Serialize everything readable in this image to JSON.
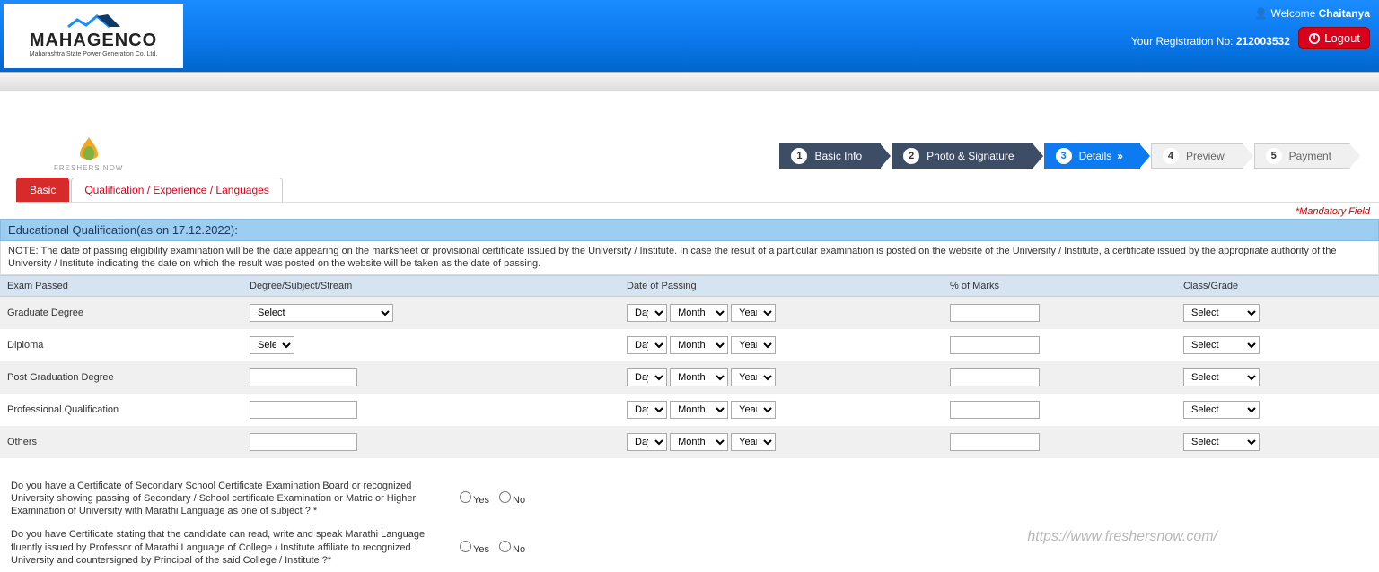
{
  "header": {
    "logo_main": "MAHAGENCO",
    "logo_sub": "Maharashtra State Power Generation Co. Ltd.",
    "welcome_prefix": "Welcome ",
    "welcome_name": "Chaitanya",
    "reg_label": "Your Registration No: ",
    "reg_no": "212003532",
    "logout": "Logout"
  },
  "freshers": {
    "label": "FRESHERS NOW"
  },
  "wizard": {
    "s1": "Basic Info",
    "s2": "Photo & Signature",
    "s3": "Details",
    "s4": "Preview",
    "s5": "Payment"
  },
  "tabs": {
    "basic": "Basic",
    "qual": "Qualification / Experience / Languages"
  },
  "mandatory": "*Mandatory Field",
  "section_title": "Educational Qualification(as on 17.12.2022):",
  "note": "NOTE: The date of passing eligibility examination will be the date appearing on the marksheet or provisional certificate issued by the University / Institute. In case the result of a particular examination is posted on the website of the University / Institute, a certificate issued by the appropriate authority of the University / Institute indicating the date on which the result was posted on the website will be taken as the date of passing.",
  "cols": {
    "exam": "Exam Passed",
    "degree": "Degree/Subject/Stream",
    "dop": "Date of Passing",
    "marks": "% of Marks",
    "grade": "Class/Grade"
  },
  "rows": {
    "r1": "Graduate Degree",
    "r2": "Diploma",
    "r3": "Post Graduation Degree",
    "r4": "Professional Qualification",
    "r5": "Others"
  },
  "opts": {
    "select": "Select",
    "day": "Day",
    "month": "Month",
    "year": "Year"
  },
  "q1": "Do you have a Certificate of Secondary School Certificate Examination Board or recognized University showing passing of Secondary / School certificate Examination or Matric or Higher Examination of University with Marathi Language as one of subject ? *",
  "q2": "Do you have Certificate stating that the candidate can read, write and speak Marathi Language fluently issued by Professor of Marathi Language of College / Institute affiliate to recognized University and countersigned by Principal of the said College / Institute ?*",
  "yes": "Yes",
  "no": "No",
  "watermark": "https://www.freshersnow.com/"
}
